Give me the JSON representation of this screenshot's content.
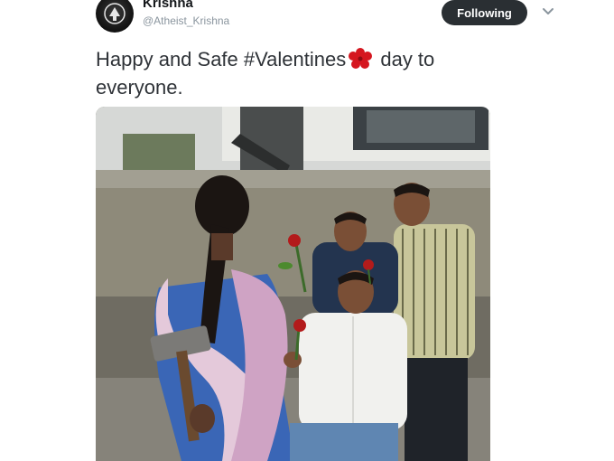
{
  "tweet": {
    "author_name": "Krishna",
    "author_handle": "@Atheist_Krishna",
    "follow_label": "Following",
    "text_before_emoji": "Happy and Safe #Valentines",
    "text_after_emoji": " day to everyone.",
    "emoji_icon": "rose-icon",
    "media_icon": "photo-image"
  },
  "colors": {
    "button_bg": "#2a2f33",
    "handle_gray": "#8a959e",
    "text": "#2f3338",
    "rose_red": "#d5161f"
  }
}
